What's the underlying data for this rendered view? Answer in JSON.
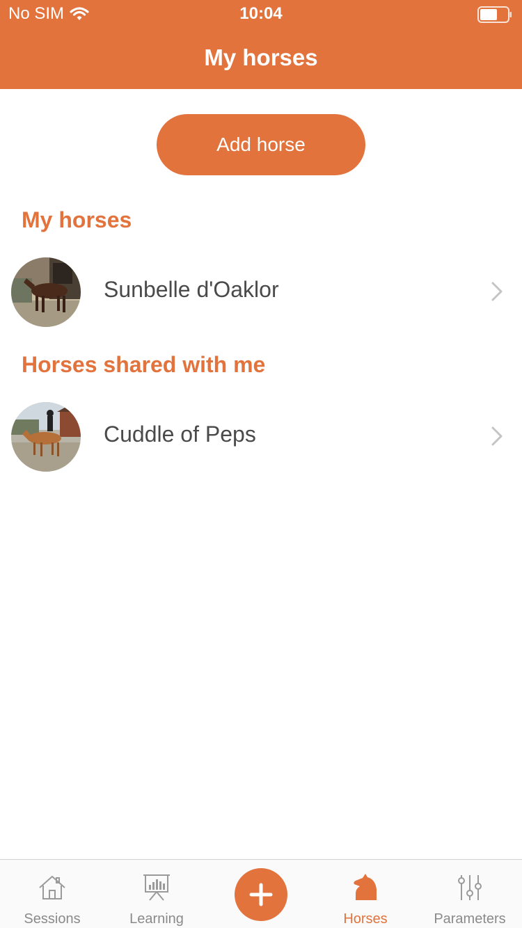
{
  "status_bar": {
    "carrier": "No SIM",
    "time": "10:04"
  },
  "header": {
    "title": "My horses"
  },
  "actions": {
    "add_horse_label": "Add horse"
  },
  "sections": {
    "my_horses": {
      "title": "My horses",
      "items": [
        {
          "name": "Sunbelle d'Oaklor"
        }
      ]
    },
    "shared": {
      "title": "Horses shared with me",
      "items": [
        {
          "name": "Cuddle of Peps"
        }
      ]
    }
  },
  "tab_bar": {
    "items": [
      {
        "label": "Sessions",
        "icon": "house-icon"
      },
      {
        "label": "Learning",
        "icon": "presentation-chart-icon"
      },
      {
        "label": "",
        "icon": "plus-icon"
      },
      {
        "label": "Horses",
        "icon": "horse-head-icon",
        "active": true
      },
      {
        "label": "Parameters",
        "icon": "sliders-icon"
      }
    ]
  },
  "colors": {
    "accent": "#E2733C",
    "text": "#4a4a4a",
    "inactive": "#8a8a8a"
  }
}
